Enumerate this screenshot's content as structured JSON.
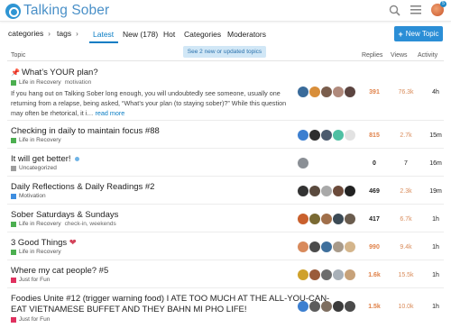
{
  "site": {
    "name": "Talking Sober",
    "notification_count": "5"
  },
  "nav": {
    "categories_dd": "categories",
    "tags_dd": "tags",
    "tabs": [
      "Latest",
      "New (178)",
      "Hot",
      "Categories",
      "Moderators"
    ],
    "new_topic": "New Topic"
  },
  "banner": "See 2 new or updated topics",
  "columns": {
    "topic": "Topic",
    "replies": "Replies",
    "views": "Views",
    "activity": "Activity"
  },
  "topics": [
    {
      "title": "What’s YOUR plan?",
      "category": "Life in Recovery",
      "tags": "motivation",
      "excerpt": "If you hang out on Talking Sober long enough, you will undoubtedly see someone, usually one returning from a relapse, being asked, “What’s your plan (to staying sober)?” While this question may often be rhetorical, it i…",
      "read_more": "read more",
      "replies": "391",
      "views": "76.3k",
      "activity": "4h"
    },
    {
      "title": "Checking in daily to maintain focus #88",
      "category": "Life in Recovery",
      "tags": "",
      "replies": "815",
      "views": "2.7k",
      "activity": "15m"
    },
    {
      "title": "It will get better!",
      "category": "Uncategorized",
      "tags": "",
      "replies": "0",
      "views": "7",
      "activity": "16m"
    },
    {
      "title": "Daily Reflections & Daily Readings #2",
      "category": "Motivation",
      "tags": "",
      "replies": "469",
      "views": "2.3k",
      "activity": "19m"
    },
    {
      "title": "Sober Saturdays & Sundays",
      "category": "Life in Recovery",
      "tags": "check-in, weekends",
      "replies": "417",
      "views": "6.7k",
      "activity": "1h"
    },
    {
      "title": "3 Good Things",
      "category": "Life in Recovery",
      "tags": "",
      "replies": "990",
      "views": "9.4k",
      "activity": "1h"
    },
    {
      "title": "Where my cat people? #5",
      "category": "Just for Fun",
      "tags": "",
      "replies": "1.6k",
      "views": "15.5k",
      "activity": "1h"
    },
    {
      "title": "Foodies Unite #12 (trigger warning food) I ATE TOO MUCH AT THE ALL-YOU-CAN-",
      "title2": "EAT VIETNAMESE BUFFET AND THEY BAHN MI PHO LIFE!",
      "category": "Just for Fun",
      "tags": "",
      "replies": "1.5k",
      "views": "10.0k",
      "activity": "1h"
    }
  ],
  "colors": {
    "life_in_recovery": "#4caf50",
    "uncategorized": "#9e9e9e",
    "motivation": "#3e8ee0",
    "just_for_fun": "#e0315f",
    "accent": "#0a7dc4"
  }
}
